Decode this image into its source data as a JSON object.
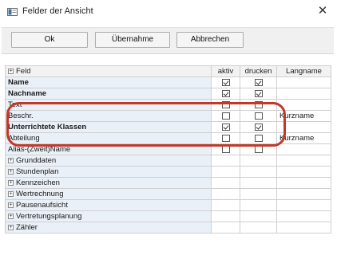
{
  "window": {
    "title": "Felder der Ansicht",
    "close_glyph": "✕",
    "icon": "window-app-icon"
  },
  "toolbar": {
    "ok_label": "Ok",
    "uebernahme_label": "Übernahme",
    "abbrechen_label": "Abbrechen"
  },
  "grid": {
    "columns": {
      "feld": "Feld",
      "aktiv": "aktiv",
      "drucken": "drucken",
      "langname": "Langname"
    },
    "rows": [
      {
        "name": "Name",
        "bold": true,
        "aktiv": true,
        "drucken": true,
        "langname": ""
      },
      {
        "name": "Nachname",
        "bold": true,
        "aktiv": true,
        "drucken": true,
        "langname": ""
      },
      {
        "name": "Text",
        "bold": false,
        "aktiv": false,
        "drucken": false,
        "langname": ""
      },
      {
        "name": "Beschr.",
        "bold": false,
        "aktiv": false,
        "drucken": false,
        "langname": "Kurzname"
      },
      {
        "name": "Unterrichtete Klassen",
        "bold": true,
        "aktiv": true,
        "drucken": true,
        "langname": ""
      },
      {
        "name": "Abteilung",
        "bold": false,
        "aktiv": false,
        "drucken": false,
        "langname": "Kurzname"
      },
      {
        "name": "Alias-(Zweit)Name",
        "bold": false,
        "aktiv": false,
        "drucken": false,
        "langname": ""
      }
    ],
    "groups": [
      "Grunddaten",
      "Stundenplan",
      "Kennzeichen",
      "Wertrechnung",
      "Pausenaufsicht",
      "Vertretungsplanung",
      "Zähler"
    ]
  },
  "colors": {
    "highlight": "#c0392b",
    "name_cell": "#eaf0f8"
  }
}
